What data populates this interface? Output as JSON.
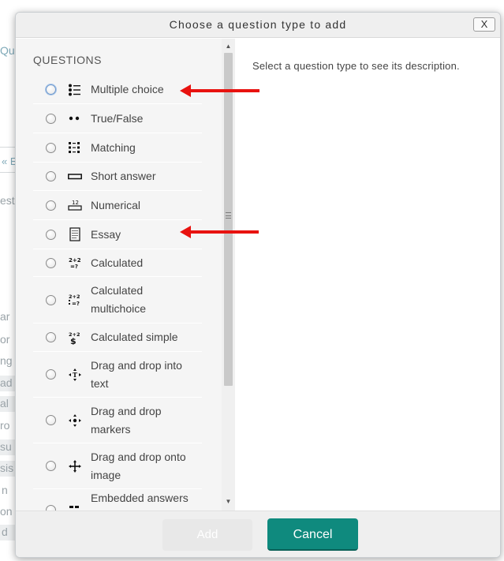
{
  "background": {
    "fragments": [
      "Qu",
      "« E",
      "est",
      "ar",
      "or",
      "ng",
      "ad",
      "al",
      "ro",
      "su",
      "sis",
      "n",
      "on",
      "d"
    ]
  },
  "dialog": {
    "title": "Choose a question type to add",
    "close_label": "X",
    "section_heading": "QUESTIONS",
    "description_placeholder": "Select a question type to see its description.",
    "questions": [
      {
        "label": "Multiple choice",
        "icon": "multiple-choice-icon",
        "selected": true
      },
      {
        "label": "True/False",
        "icon": "true-false-icon",
        "selected": false
      },
      {
        "label": "Matching",
        "icon": "matching-icon",
        "selected": false
      },
      {
        "label": "Short answer",
        "icon": "short-answer-icon",
        "selected": false
      },
      {
        "label": "Numerical",
        "icon": "numerical-icon",
        "selected": false
      },
      {
        "label": "Essay",
        "icon": "essay-icon",
        "selected": false
      },
      {
        "label": "Calculated",
        "icon": "calculated-icon",
        "selected": false
      },
      {
        "label": "Calculated multichoice",
        "icon": "calculated-multichoice-icon",
        "selected": false
      },
      {
        "label": "Calculated simple",
        "icon": "calculated-simple-icon",
        "selected": false
      },
      {
        "label": "Drag and drop into text",
        "icon": "drag-drop-text-icon",
        "selected": false
      },
      {
        "label": "Drag and drop markers",
        "icon": "drag-drop-markers-icon",
        "selected": false
      },
      {
        "label": "Drag and drop onto image",
        "icon": "drag-drop-image-icon",
        "selected": false
      },
      {
        "label": "Embedded answers",
        "icon": "embedded-answers-icon",
        "selected": false
      }
    ],
    "add_label": "Add",
    "cancel_label": "Cancel"
  },
  "colors": {
    "accent": "#0f8a7e",
    "annotation_arrow": "#e8120f"
  }
}
